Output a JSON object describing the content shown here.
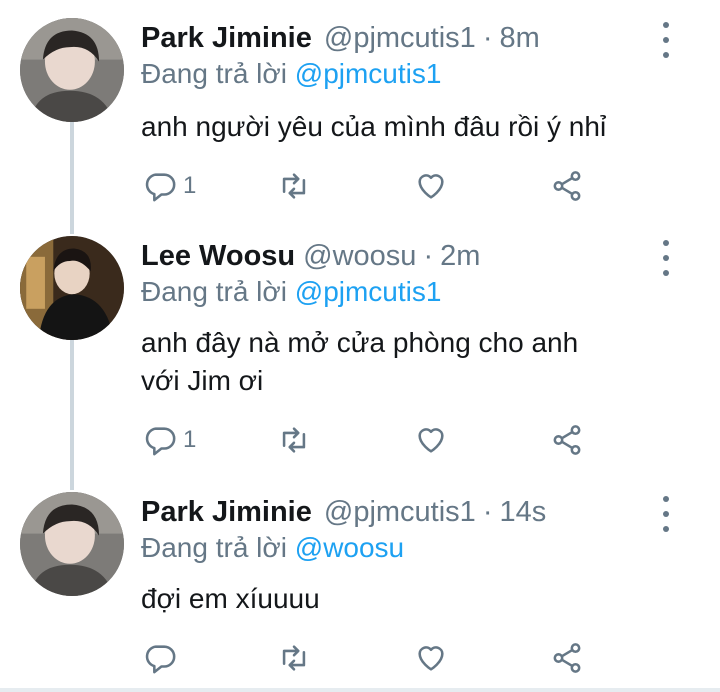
{
  "tweets": [
    {
      "name": "Park Jiminie",
      "handle": "@pjmcutis1",
      "separator": "·",
      "time": "8m",
      "reply_prefix": "Đang trả lời ",
      "reply_to": "@pjmcutis1",
      "text_lines": [
        "anh người yêu của mình đâu rồi ý nhỉ"
      ],
      "reply_count": "1",
      "avatar": "avatar-park-jiminie"
    },
    {
      "name": "Lee Woosu",
      "handle": "@woosu",
      "separator": "·",
      "time": "2m",
      "reply_prefix": "Đang trả lời ",
      "reply_to": "@pjmcutis1",
      "text_lines": [
        "anh đây nà mở cửa phòng cho anh",
        "với Jim ơi"
      ],
      "reply_count": "1",
      "avatar": "avatar-lee-woosu"
    },
    {
      "name": "Park Jiminie",
      "handle": "@pjmcutis1",
      "separator": "·",
      "time": "14s",
      "reply_prefix": "Đang trả lời ",
      "reply_to": "@woosu",
      "text_lines": [
        "đợi em xíuuuu"
      ],
      "reply_count": "",
      "avatar": "avatar-park-jiminie"
    }
  ],
  "icons": {
    "reply": "reply-icon",
    "retweet": "retweet-icon",
    "like": "heart-icon",
    "share": "share-icon",
    "more": "more-vertical-icon"
  },
  "colors": {
    "accent": "#1da1f2",
    "secondary_text": "#657786",
    "primary_text": "#14171a",
    "thread_line": "#ccd6dd"
  }
}
